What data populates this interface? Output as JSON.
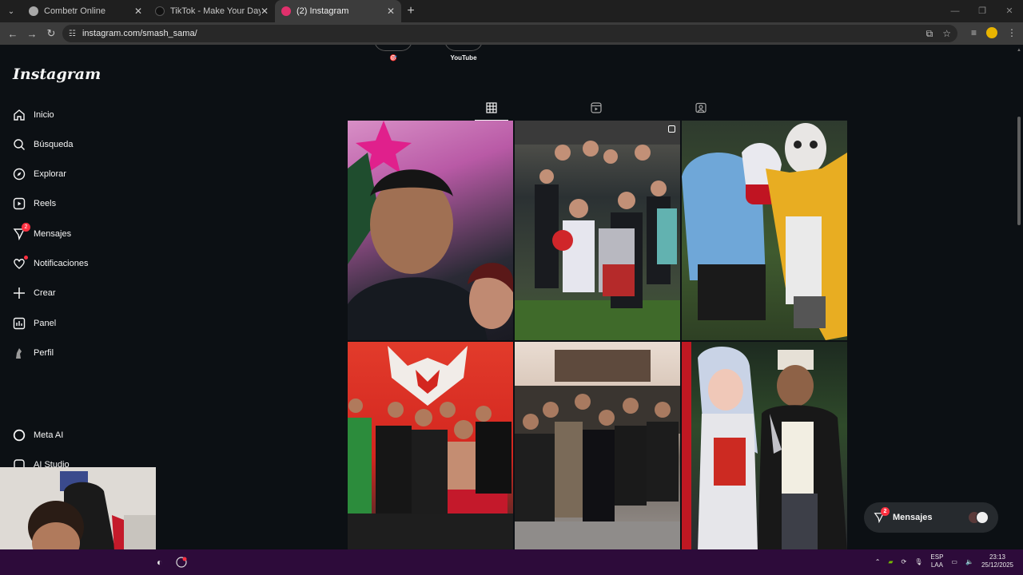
{
  "browser": {
    "tabs": [
      {
        "title": "Combetr Online",
        "active": false,
        "favicon_color": "#a8a8a8"
      },
      {
        "title": "TikTok - Make Your Day",
        "active": false,
        "favicon_color": "#111111"
      },
      {
        "title": "(2) Instagram",
        "active": true,
        "favicon_color": "#e1306c"
      }
    ],
    "url": "instagram.com/smash_sama/"
  },
  "instagram": {
    "logo": "Instagram",
    "nav": [
      {
        "label": "Inicio",
        "icon": "home-icon"
      },
      {
        "label": "Búsqueda",
        "icon": "search-icon"
      },
      {
        "label": "Explorar",
        "icon": "compass-icon"
      },
      {
        "label": "Reels",
        "icon": "reels-icon"
      },
      {
        "label": "Mensajes",
        "icon": "messenger-icon",
        "badge": "2"
      },
      {
        "label": "Notificaciones",
        "icon": "heart-icon",
        "dot": true
      },
      {
        "label": "Crear",
        "icon": "plus-icon"
      },
      {
        "label": "Panel",
        "icon": "chart-icon"
      },
      {
        "label": "Perfil",
        "icon": "avatar-icon"
      },
      {
        "label": "Meta AI",
        "icon": "meta-ai-icon"
      },
      {
        "label": "AI Studio",
        "icon": "ai-studio-icon"
      }
    ],
    "highlights": [
      {
        "label": "🎯"
      },
      {
        "label": "YouTube"
      }
    ],
    "profile_tabs": [
      "posts-grid-icon",
      "reels-tab-icon",
      "tagged-icon"
    ],
    "messages_pill": {
      "label": "Mensajes",
      "badge": "2"
    }
  },
  "taskbar": {
    "lang": "ESP",
    "lang_sub": "LAA",
    "time": "23:13",
    "date": "25/12/2025"
  }
}
